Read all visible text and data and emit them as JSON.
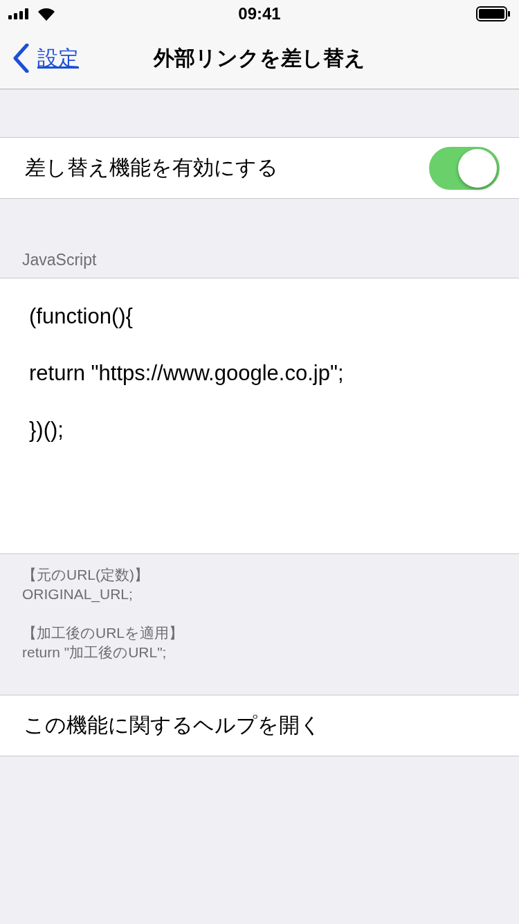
{
  "status_bar": {
    "time": "09:41"
  },
  "nav_bar": {
    "back_label": "設定",
    "title": "外部リンクを差し替え"
  },
  "toggle_row": {
    "label": "差し替え機能を有効にする",
    "on": true
  },
  "script_section": {
    "header": "JavaScript",
    "code": "(function(){\n\nreturn \"https://www.google.co.jp\";\n\n})();"
  },
  "notes": [
    {
      "label": "【元のURL(定数)】",
      "value": "ORIGINAL_URL;"
    },
    {
      "label": "【加工後のURLを適用】",
      "value": "return \"加工後のURL\";"
    }
  ],
  "help_row": {
    "label": "この機能に関するヘルプを開く"
  }
}
